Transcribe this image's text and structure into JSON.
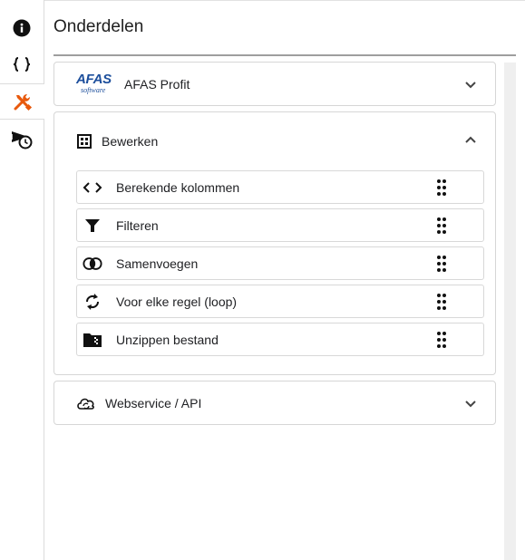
{
  "page": {
    "title": "Onderdelen"
  },
  "rail": {
    "items": [
      {
        "icon": "info-icon",
        "active": false
      },
      {
        "icon": "braces-icon",
        "active": false
      },
      {
        "icon": "tools-icon",
        "active": true,
        "color": "#e8590c"
      },
      {
        "icon": "schedule-send-icon",
        "active": false
      }
    ]
  },
  "sections": {
    "afas": {
      "label": "AFAS Profit",
      "logo_main": "AFAS",
      "logo_sub": "software",
      "expanded": false
    },
    "bewerken": {
      "label": "Bewerken",
      "expanded": true,
      "items": [
        {
          "label": "Berekende kolommen",
          "icon": "code-brackets-icon"
        },
        {
          "label": "Filteren",
          "icon": "filter-icon"
        },
        {
          "label": "Samenvoegen",
          "icon": "merge-circles-icon"
        },
        {
          "label": "Voor elke regel (loop)",
          "icon": "loop-icon"
        },
        {
          "label": "Unzippen bestand",
          "icon": "zip-folder-icon"
        }
      ]
    },
    "webservice": {
      "label": "Webservice / API",
      "expanded": false
    }
  },
  "colors": {
    "accent": "#e8590c",
    "afas_blue": "#1d4f9c",
    "text": "#202124"
  }
}
